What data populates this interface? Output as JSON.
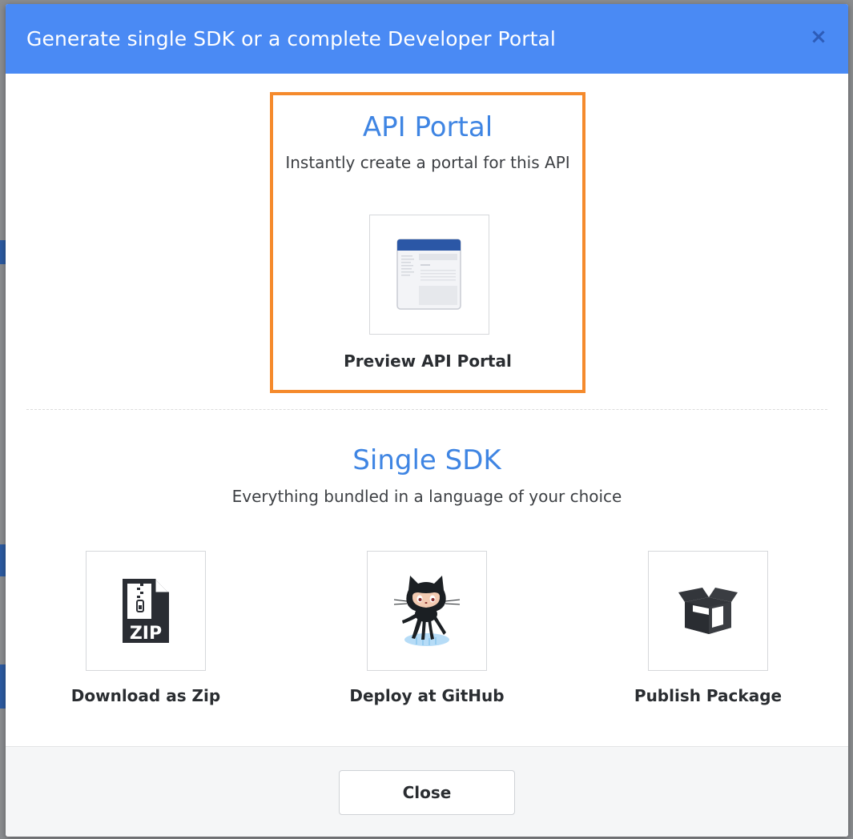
{
  "modal": {
    "title": "Generate single SDK or a complete Developer Portal",
    "close_icon": "close-icon"
  },
  "portal": {
    "heading": "API Portal",
    "subtitle": "Instantly create a portal for this API",
    "preview": {
      "label": "Preview API Portal",
      "icon": "portal-preview-icon"
    }
  },
  "sdk": {
    "heading": "Single SDK",
    "subtitle": "Everything bundled in a language of your choice",
    "options": [
      {
        "label": "Download as Zip",
        "icon": "zip-file-icon"
      },
      {
        "label": "Deploy at GitHub",
        "icon": "github-octocat-icon"
      },
      {
        "label": "Publish Package",
        "icon": "package-box-icon"
      }
    ]
  },
  "footer": {
    "close_label": "Close"
  },
  "colors": {
    "header_bg": "#4a8af4",
    "accent_blue": "#3f85e3",
    "highlight_border": "#f58a2c",
    "close_x": "#2d5cb8"
  }
}
